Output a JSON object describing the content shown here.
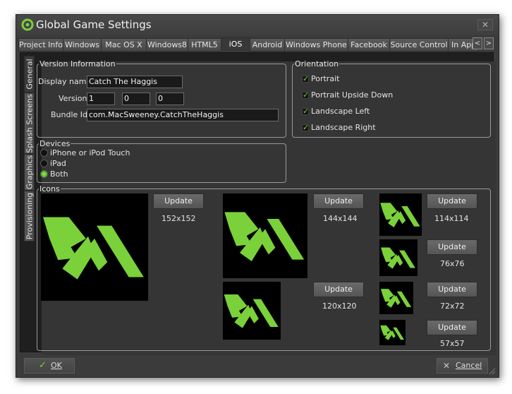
{
  "window": {
    "title": "Global Game Settings",
    "close_glyph": "✕"
  },
  "tabs": [
    "Project Info",
    "Windows",
    "Mac OS X",
    "Windows8",
    "HTML5",
    "iOS",
    "Android",
    "Windows Phone",
    "Facebook",
    "Source Control",
    "In App"
  ],
  "active_tab": "iOS",
  "tab_scroll": {
    "left": "<",
    "right": ">"
  },
  "side_tabs": [
    "General",
    "Splash Screens",
    "Graphics",
    "Provisioning"
  ],
  "version_info": {
    "legend": "Version Information",
    "display_name_label": "Display name",
    "display_name_value": "Catch The Haggis",
    "version_label": "Version",
    "version_values": [
      "1",
      "0",
      "0"
    ],
    "bundle_label": "Bundle Id",
    "bundle_value": "com.MacSweeney.CatchTheHaggis"
  },
  "devices": {
    "legend": "Devices",
    "options": [
      "iPhone or iPod Touch",
      "iPad",
      "Both"
    ],
    "selected": "Both"
  },
  "orientation": {
    "legend": "Orientation",
    "options": [
      "Portrait",
      "Portrait Upside Down",
      "Landscape Left",
      "Landscape Right"
    ],
    "checked": [
      true,
      true,
      true,
      true
    ]
  },
  "icons": {
    "legend": "Icons",
    "update_label": "Update",
    "sizes": [
      "152x152",
      "144x144",
      "114x114",
      "76x76",
      "120x120",
      "72x72",
      "57x57"
    ]
  },
  "footer": {
    "ok_label": "OK",
    "cancel_label": "Cancel"
  },
  "colors": {
    "accent": "#7ad13a",
    "background": "#353535"
  }
}
